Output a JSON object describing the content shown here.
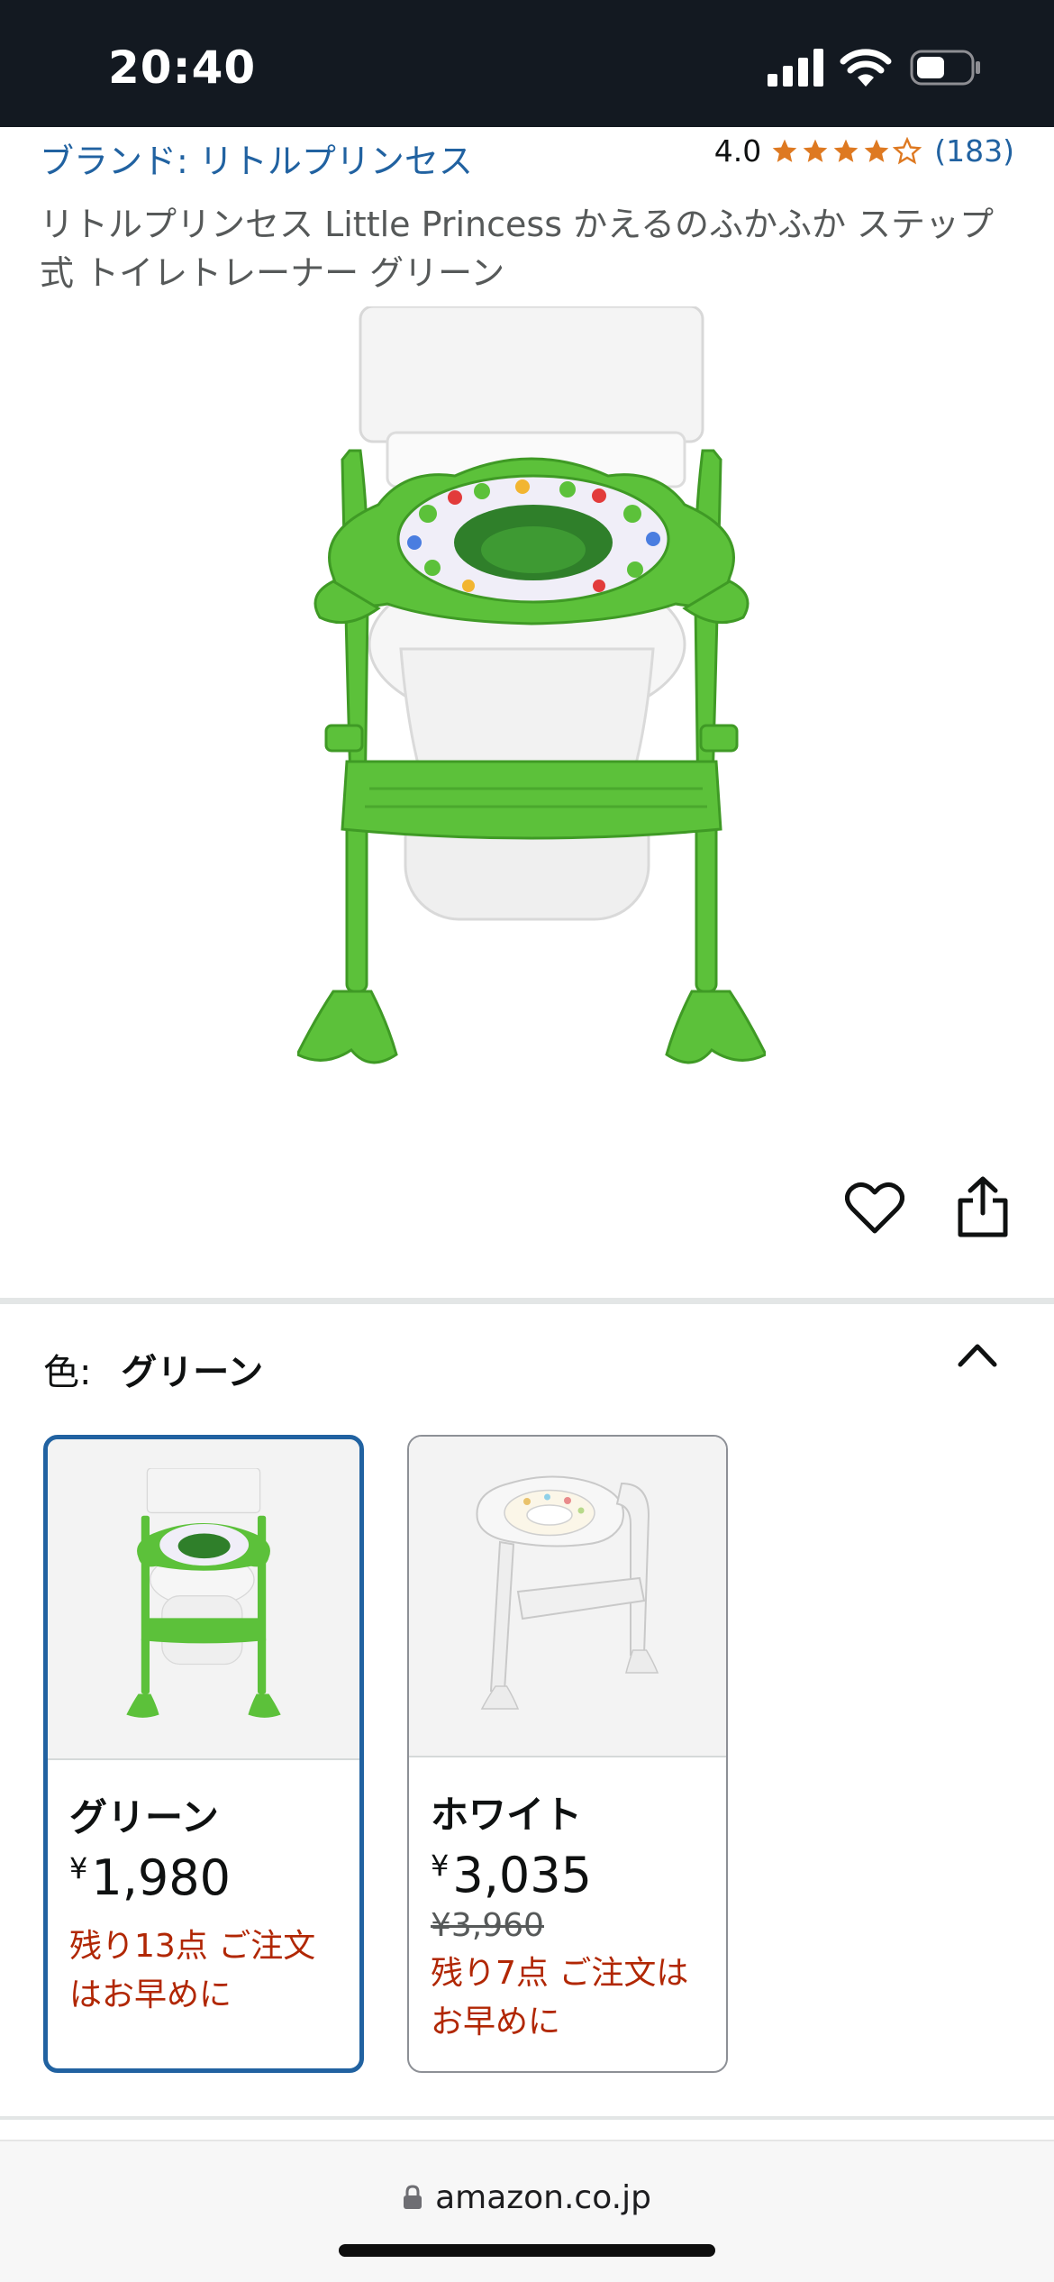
{
  "status_bar": {
    "time": "20:40"
  },
  "header": {
    "brand": "ブランド: リトルプリンセス",
    "rating_value": "4.0",
    "rating_stars": 4.0,
    "rating_count": "(183)"
  },
  "product": {
    "title": "リトルプリンセス Little Princess かえるのふかふか ステップ式 トイレトレーナー グリーン"
  },
  "colors": {
    "accent": "#2162a1",
    "rating_star": "#de7921",
    "stock_warning": "#b12704",
    "frog_green": "#5cc13a"
  },
  "color_selector": {
    "label": "色:",
    "selected": "グリーン",
    "variants": [
      {
        "name": "グリーン",
        "yen": "¥",
        "price": "1,980",
        "list_price": "",
        "stock": "残り13点 ご注文はお早めに"
      },
      {
        "name": "ホワイト",
        "yen": "¥",
        "price": "3,035",
        "list_price": "¥3,960",
        "stock": "残り7点 ご注文はお早めに"
      }
    ]
  },
  "browser": {
    "url": "amazon.co.jp"
  }
}
